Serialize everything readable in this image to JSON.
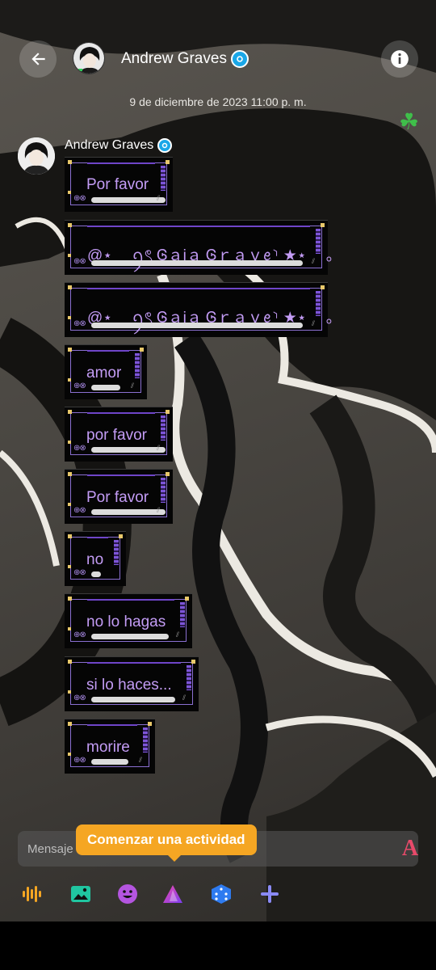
{
  "header": {
    "contact_name": "Andrew Graves",
    "back_icon": "arrow-left-icon",
    "info_icon": "info-icon"
  },
  "conversation": {
    "date": "9 de diciembre de 2023 11:00 p. m.",
    "sender_name": "Andrew Graves",
    "messages": [
      {
        "text": "Por favor"
      },
      {
        "text": "@⋆ 　ꪆৎ Ꮆａịａ Ꮆｒａｖꫀ⸃ ★⋆ 　｡"
      },
      {
        "text": "@⋆ 　ꪆৎ Ꮆａịａ Ꮆｒａｖꫀ⸃ ★⋆ 　｡"
      },
      {
        "text": "amor"
      },
      {
        "text": "por favor"
      },
      {
        "text": "Por favor"
      },
      {
        "text": "no"
      },
      {
        "text": "no lo hagas"
      },
      {
        "text": "si lo haces..."
      },
      {
        "text": "morire"
      }
    ]
  },
  "composer": {
    "placeholder": "Mensaje",
    "tooltip": "Comenzar una actividad",
    "font_button": "A"
  },
  "toolbar": {
    "items": [
      "voice-icon",
      "image-icon",
      "emoji-icon",
      "activity-icon",
      "dice-icon",
      "plus-icon"
    ]
  },
  "colors": {
    "bubble_text": "#c39cf5",
    "tooltip": "#f5a623",
    "verified": "#1aa7e8"
  }
}
